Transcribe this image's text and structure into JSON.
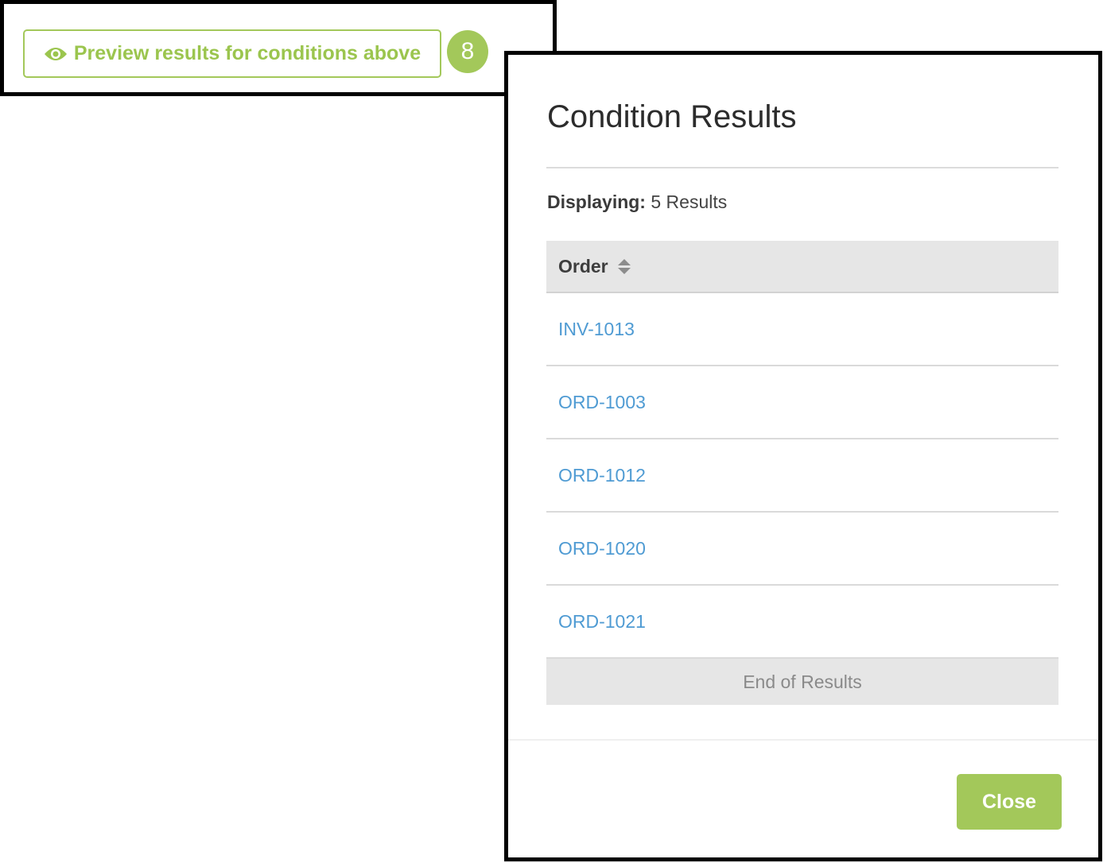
{
  "preview": {
    "button_label": "Preview results for conditions above",
    "count": "8",
    "icon": "eye-icon"
  },
  "modal": {
    "title": "Condition Results",
    "summary_label": "Displaying:",
    "summary_value": "5 Results",
    "table": {
      "column_header": "Order",
      "rows": [
        "INV-1013",
        "ORD-1003",
        "ORD-1012",
        "ORD-1020",
        "ORD-1021"
      ],
      "end_text": "End of Results"
    },
    "close_label": "Close"
  },
  "colors": {
    "accent_green": "#a3c85a",
    "link_blue": "#4f9bd3"
  }
}
